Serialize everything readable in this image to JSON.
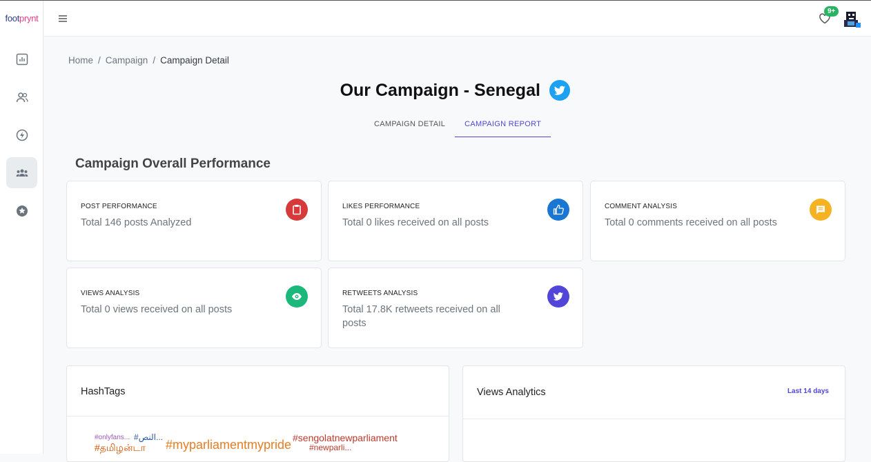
{
  "logo": {
    "part1": "foot",
    "part2": "prynt"
  },
  "sidebar": {
    "items": [
      {
        "icon": "chart-icon",
        "name": "sidebar-item-dashboard"
      },
      {
        "icon": "users-icon",
        "name": "sidebar-item-users"
      },
      {
        "icon": "lightning-icon",
        "name": "sidebar-item-campaigns"
      },
      {
        "icon": "group-icon",
        "name": "sidebar-item-groups",
        "active": true
      },
      {
        "icon": "star-icon",
        "name": "sidebar-item-favorites"
      }
    ]
  },
  "header": {
    "notification_badge": "9+"
  },
  "breadcrumb": {
    "home": "Home",
    "campaign": "Campaign",
    "current": "Campaign Detail"
  },
  "page": {
    "title": "Our Campaign - Senegal",
    "platform_icon": "twitter-icon"
  },
  "tabs": [
    {
      "label": "CAMPAIGN DETAIL",
      "active": false
    },
    {
      "label": "CAMPAIGN REPORT",
      "active": true
    }
  ],
  "section": {
    "title": "Campaign Overall Performance"
  },
  "cards": [
    {
      "label": "POST PERFORMANCE",
      "desc": "Total 146 posts Analyzed",
      "icon": "clipboard-icon",
      "color": "#d63a3a"
    },
    {
      "label": "LIKES PERFORMANCE",
      "desc": "Total 0 likes received on all posts",
      "icon": "thumbs-up-icon",
      "color": "#1976d2"
    },
    {
      "label": "COMMENT ANALYSIS",
      "desc": "Total 0 comments received on all posts",
      "icon": "comment-icon",
      "color": "#f5b324"
    },
    {
      "label": "VIEWS ANALYSIS",
      "desc": "Total 0 views received on all posts",
      "icon": "eye-icon",
      "color": "#1bb77b"
    },
    {
      "label": "RETWEETS ANALYSIS",
      "desc": "Total 17.8K retweets received on all posts",
      "icon": "twitter-icon",
      "color": "#5146d8"
    }
  ],
  "hashtags": {
    "title": "HashTags",
    "words": [
      {
        "text": "#onlyfans...",
        "color": "#9b59b6"
      },
      {
        "text": "#النص...",
        "color": "#2c5aa0"
      },
      {
        "text": "#myparliamentmypride",
        "color": "#e67e22"
      },
      {
        "text": "#sengolatnewparliament",
        "color": "#c0392b"
      },
      {
        "text": "#தமிழன்டா",
        "color": "#d35400"
      },
      {
        "text": "#newparli...",
        "color": "#c0392b"
      }
    ]
  },
  "views": {
    "title": "Views Analytics",
    "range": "Last 14 days"
  }
}
